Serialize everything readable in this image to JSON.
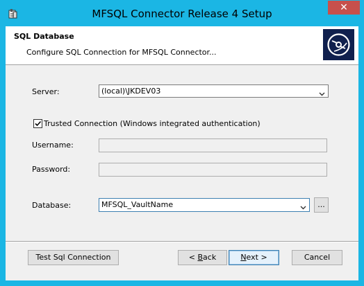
{
  "window": {
    "title": "MFSQL Connector Release 4 Setup",
    "close_glyph": "✕"
  },
  "header": {
    "title": "SQL Database",
    "subtitle": "Configure SQL Connection for MFSQL Connector..."
  },
  "form": {
    "server_label": "Server:",
    "server_value": "(local)\\JKDEV03",
    "trusted_label": "Trusted Connection (Windows integrated authentication)",
    "trusted_checked": true,
    "username_label": "Username:",
    "username_value": "",
    "password_label": "Password:",
    "password_value": "",
    "database_label": "Database:",
    "database_value": "MFSQL_VaultName",
    "browse_label": "..."
  },
  "buttons": {
    "test_label": "Test Sql Connection",
    "back_prefix": "< ",
    "back_mnemonic": "B",
    "back_rest": "ack",
    "next_mnemonic": "N",
    "next_rest": "ext >",
    "cancel_label": "Cancel"
  },
  "icons": {
    "app": "setup-package-icon",
    "logo": "disc-logo-icon",
    "dropdown": "chevron-down-icon",
    "check": "checkmark-icon"
  },
  "colors": {
    "titlebar": "#1bb6e4",
    "close": "#c7504c",
    "logo_bg": "#10204e"
  }
}
